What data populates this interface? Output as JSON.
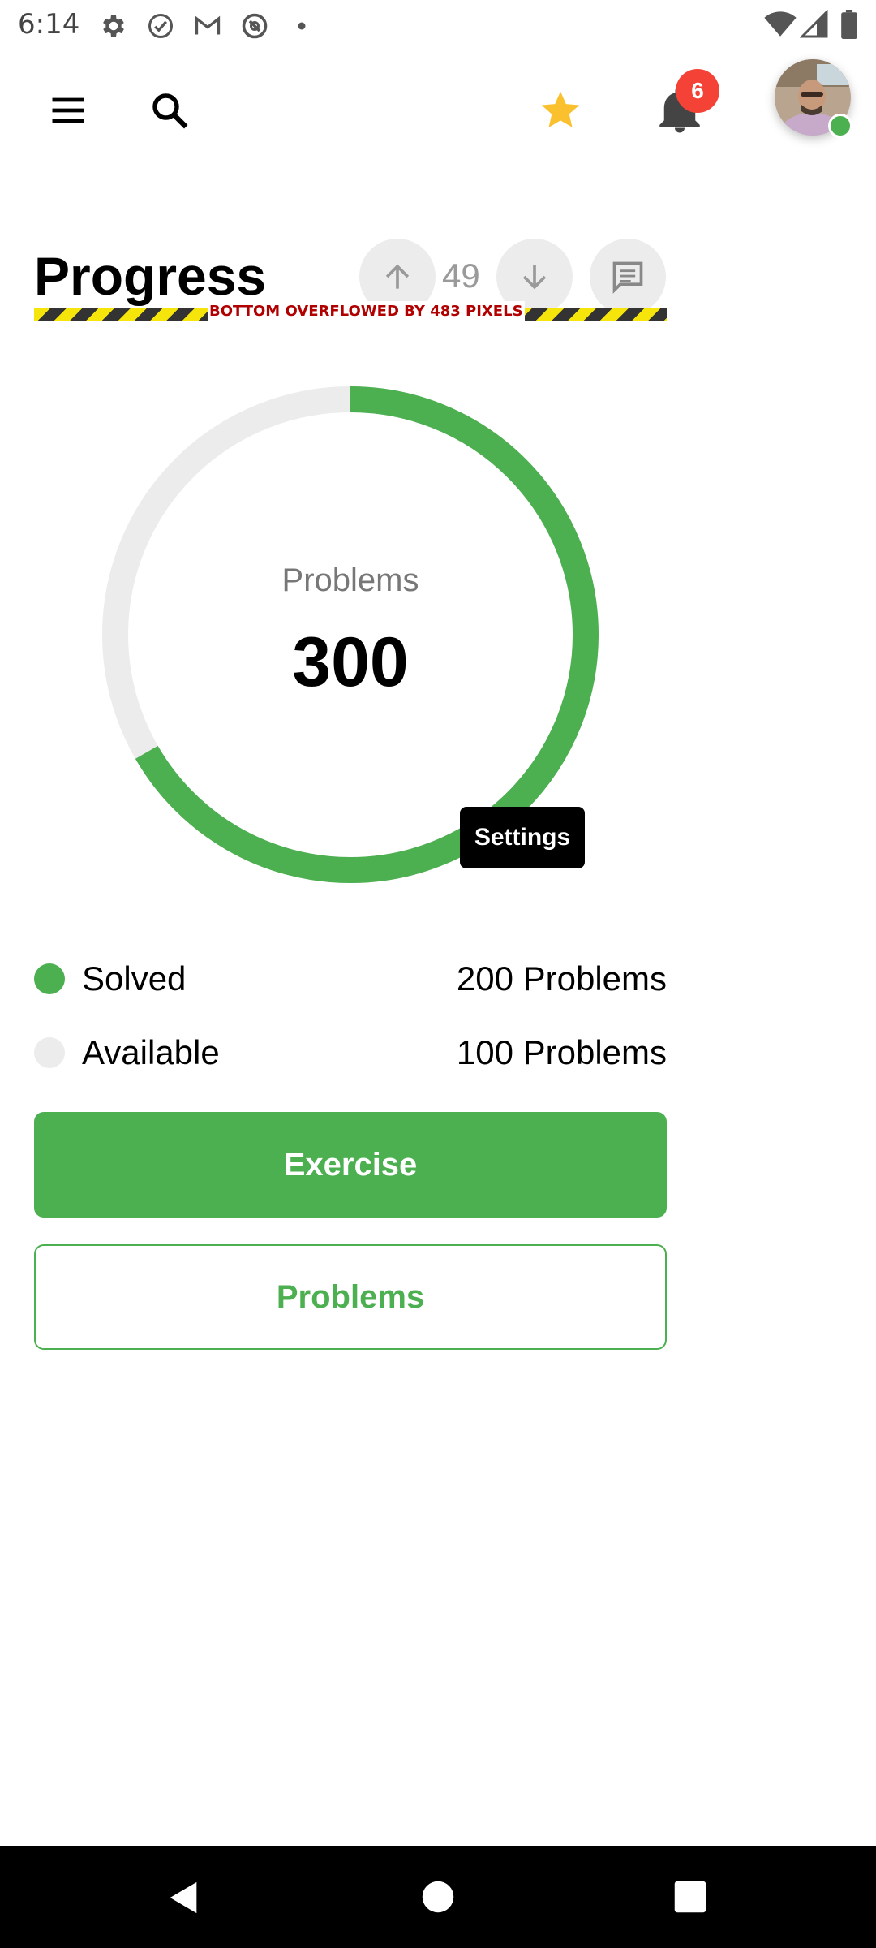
{
  "status_bar": {
    "time": "6:14",
    "left_icons": [
      "settings-icon",
      "check-circle-icon",
      "gmail-icon",
      "at-sign-icon",
      "dot-icon"
    ],
    "right_icons": [
      "wifi-icon",
      "signal-icon",
      "battery-icon"
    ]
  },
  "app_bar": {
    "icons": [
      "menu-icon",
      "search-icon",
      "star-icon",
      "bell-icon"
    ],
    "notifications_count": "6",
    "star_color": "#FBC02D"
  },
  "header": {
    "title": "Progress",
    "vote_count": "49",
    "overflow_warning": "BOTTOM OVERFLOWED BY 483 PIXELS"
  },
  "progress": {
    "center_label": "Problems",
    "center_value": "300",
    "solved_fraction": 0.6667,
    "accent_color": "#4CAF50",
    "track_color": "#ECECEC",
    "tooltip": "Settings"
  },
  "legend": [
    {
      "label": "Solved",
      "value": "200 Problems",
      "color": "#4CAF50"
    },
    {
      "label": "Available",
      "value": "100 Problems",
      "color": "#ECECEC"
    }
  ],
  "actions": {
    "primary_label": "Exercise",
    "secondary_label": "Problems"
  },
  "nav_bar": {
    "icons": [
      "back-icon",
      "home-icon",
      "recents-icon"
    ]
  }
}
